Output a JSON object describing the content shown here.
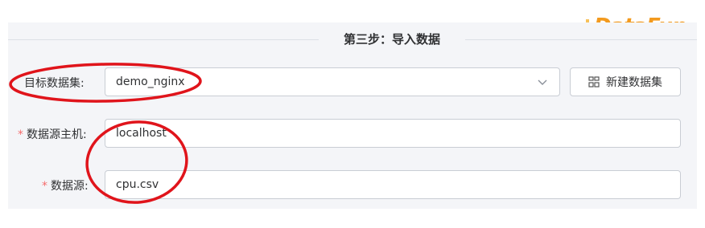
{
  "logo": {
    "text": "DataFun."
  },
  "step": {
    "title": "第三步：导入数据"
  },
  "form": {
    "dataset": {
      "label": "目标数据集:",
      "value": "demo_nginx",
      "new_button_label": "新建数据集"
    },
    "host": {
      "required_mark": "*",
      "label": "数据源主机:",
      "value": "localhost"
    },
    "source": {
      "required_mark": "*",
      "label": "数据源:",
      "value": "cpu.csv"
    }
  },
  "colors": {
    "annotation": "#e0141b",
    "logo": "#f39a1e",
    "required": "#f56c6c",
    "panel_bg": "#f4f5f8",
    "border": "#c9cdd4"
  },
  "icons": {
    "select_arrow": "chevron-down-icon",
    "new_dataset": "grid-icon",
    "logo_mark": "dots-icon"
  }
}
